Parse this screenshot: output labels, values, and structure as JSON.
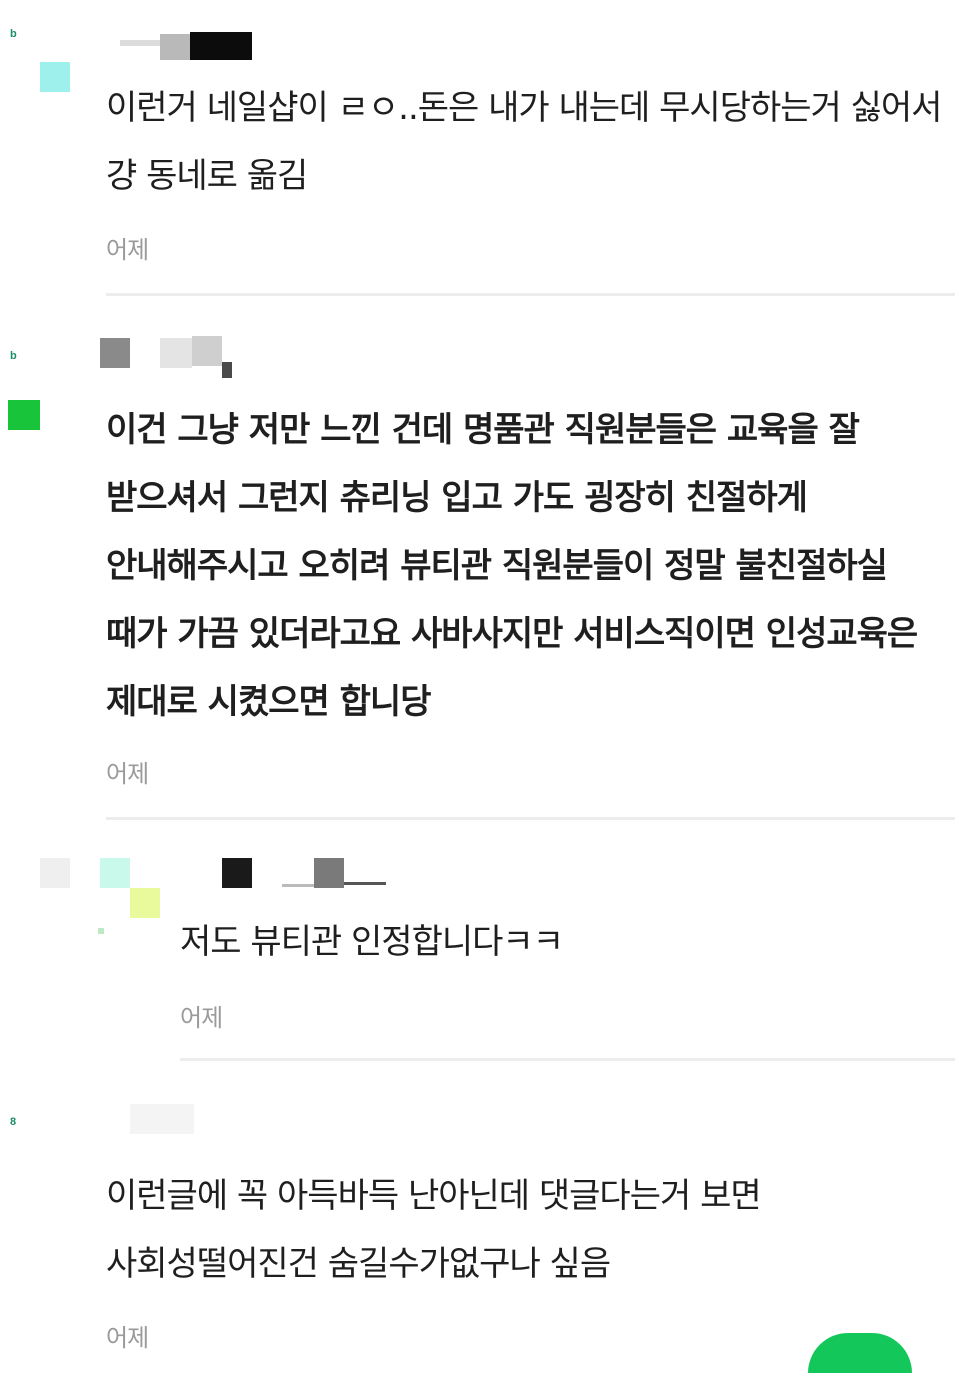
{
  "comments": [
    {
      "text": "이런거 네일샵이 ㄹㅇ..돈은 내가 내는데 무시당하는거 싫어서 걍 동네로 옮김",
      "time": "어제",
      "avatar_color": "#9ef0ec"
    },
    {
      "text": "이건 그냥 저만 느낀 건데 명품관 직원분들은 교육을 잘 받으셔서 그런지 츄리닝 입고 가도 굉장히 친절하게 안내해주시고 오히려 뷰티관 직원분들이 정말 불친절하실 때가 가끔 있더라고요 사바사지만 서비스직이면 인성교육은 제대로 시켰으면 합니당",
      "time": "어제",
      "avatar_color": "#18c53a"
    },
    {
      "text": "저도 뷰티관 인정합니다ㅋㅋ",
      "time": "어제",
      "avatar_color": "#e9fa9c",
      "is_reply": true
    },
    {
      "text": "이런글에 꼭 아득바득 난아닌데 댓글다는거 보면 사회성떨어진건 숨길수가없구나 싶음",
      "time": "어제",
      "avatar_color": "#f3f3f3"
    }
  ],
  "colors": {
    "accent_green": "#14c75a",
    "timestamp_gray": "#9a9a9a",
    "divider": "#ededed"
  }
}
